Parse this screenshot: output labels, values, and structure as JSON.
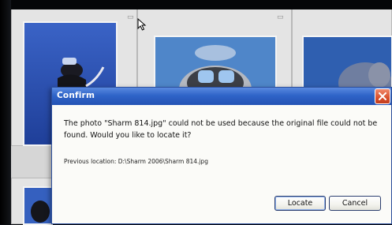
{
  "dialog": {
    "title": "Confirm",
    "message": "The photo \"Sharm 814.jpg\" could not be used because the original file could not be found. Would you like to locate it?",
    "previous_location": "Previous location: D:\\Sharm 2006\\Sharm 814.jpg",
    "locate_label": "Locate",
    "cancel_label": "Cancel"
  },
  "icons": {
    "close": "close-icon",
    "cursor": "arrow-cursor-icon",
    "flag": "thumbnail-flag-icon"
  },
  "colors": {
    "titlebar": "#2f64c8",
    "close_button": "#d9502c",
    "dialog_bg": "#fbfbf8"
  }
}
